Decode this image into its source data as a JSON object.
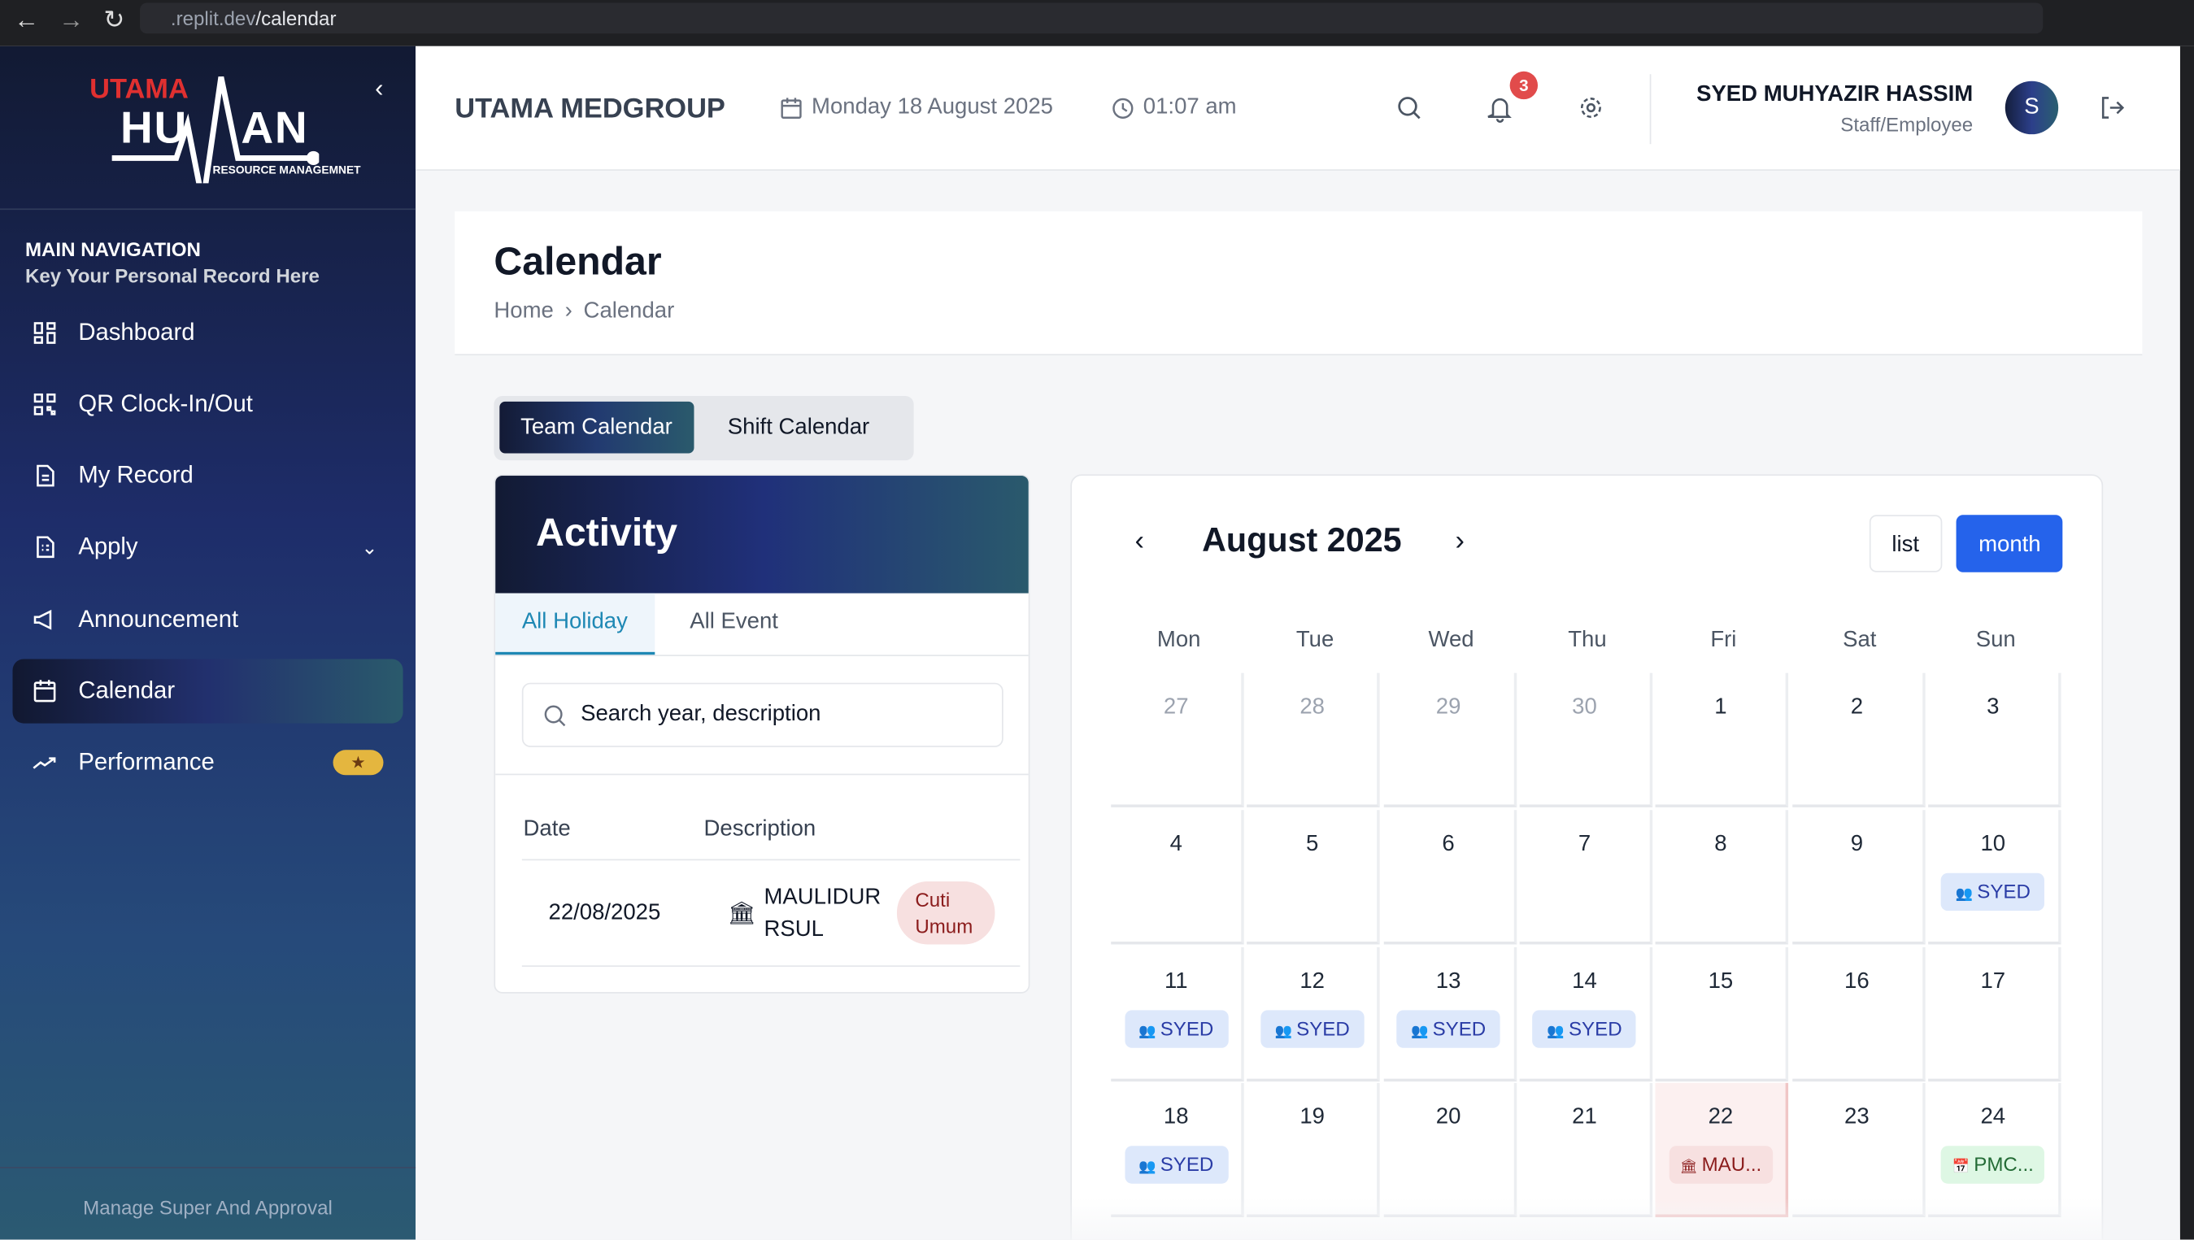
{
  "browser": {
    "url_prefix": ".replit.dev",
    "url_path": "/calendar"
  },
  "sidebar": {
    "logo": {
      "line1": "UTAMA",
      "line2": "HUMAN",
      "line3": "RESOURCE MANAGEMNET"
    },
    "nav_title": "MAIN NAVIGATION",
    "nav_subtitle": "Key Your Personal Record Here",
    "items": [
      {
        "label": "Dashboard",
        "icon": "dashboard-icon"
      },
      {
        "label": "QR Clock-In/Out",
        "icon": "qr-icon"
      },
      {
        "label": "My Record",
        "icon": "document-icon"
      },
      {
        "label": "Apply",
        "icon": "form-icon"
      },
      {
        "label": "Announcement",
        "icon": "megaphone-icon"
      },
      {
        "label": "Calendar",
        "icon": "calendar-icon",
        "active": true
      },
      {
        "label": "Performance",
        "icon": "trend-icon",
        "badge": "★"
      }
    ],
    "footer": "Manage Super And Approval"
  },
  "header": {
    "company": "UTAMA MEDGROUP",
    "date": "Monday 18 August 2025",
    "time": "01:07 am",
    "notifications": "3",
    "user_name": "SYED MUHYAZIR HASSIM",
    "user_role": "Staff/Employee",
    "avatar_initial": "S"
  },
  "page": {
    "title": "Calendar",
    "breadcrumb": [
      "Home",
      "Calendar"
    ]
  },
  "view_tabs": [
    "Team Calendar",
    "Shift Calendar"
  ],
  "activity": {
    "title": "Activity",
    "tabs": [
      "All Holiday",
      "All Event"
    ],
    "search_placeholder": "Search year, description",
    "columns": [
      "Date",
      "Description"
    ],
    "rows": [
      {
        "date": "22/08/2025",
        "description_line1": "MAULIDUR",
        "description_line2": "RSUL",
        "type": "Cuti",
        "type2": "Umum"
      }
    ]
  },
  "calendar": {
    "month_title": "August 2025",
    "buttons": [
      "list",
      "month"
    ],
    "weekdays": [
      "Mon",
      "Tue",
      "Wed",
      "Thu",
      "Fri",
      "Sat",
      "Sun"
    ],
    "weeks": [
      [
        {
          "d": "27",
          "m": 1
        },
        {
          "d": "28",
          "m": 1
        },
        {
          "d": "29",
          "m": 1
        },
        {
          "d": "30",
          "m": 1
        },
        {
          "d": "1"
        },
        {
          "d": "2"
        },
        {
          "d": "3"
        }
      ],
      [
        {
          "d": "4"
        },
        {
          "d": "5"
        },
        {
          "d": "6"
        },
        {
          "d": "7"
        },
        {
          "d": "8"
        },
        {
          "d": "9"
        },
        {
          "d": "10",
          "ev": "SYED",
          "c": "blue"
        }
      ],
      [
        {
          "d": "11",
          "ev": "SYED",
          "c": "blue"
        },
        {
          "d": "12",
          "ev": "SYED",
          "c": "blue"
        },
        {
          "d": "13",
          "ev": "SYED",
          "c": "blue"
        },
        {
          "d": "14",
          "ev": "SYED",
          "c": "blue"
        },
        {
          "d": "15"
        },
        {
          "d": "16"
        },
        {
          "d": "17"
        }
      ],
      [
        {
          "d": "18",
          "ev": "SYED",
          "c": "blue"
        },
        {
          "d": "19"
        },
        {
          "d": "20"
        },
        {
          "d": "21"
        },
        {
          "d": "22",
          "ev": "MAU...",
          "c": "red",
          "hol": 1
        },
        {
          "d": "23"
        },
        {
          "d": "24",
          "ev": "PMC...",
          "c": "green"
        }
      ]
    ]
  }
}
